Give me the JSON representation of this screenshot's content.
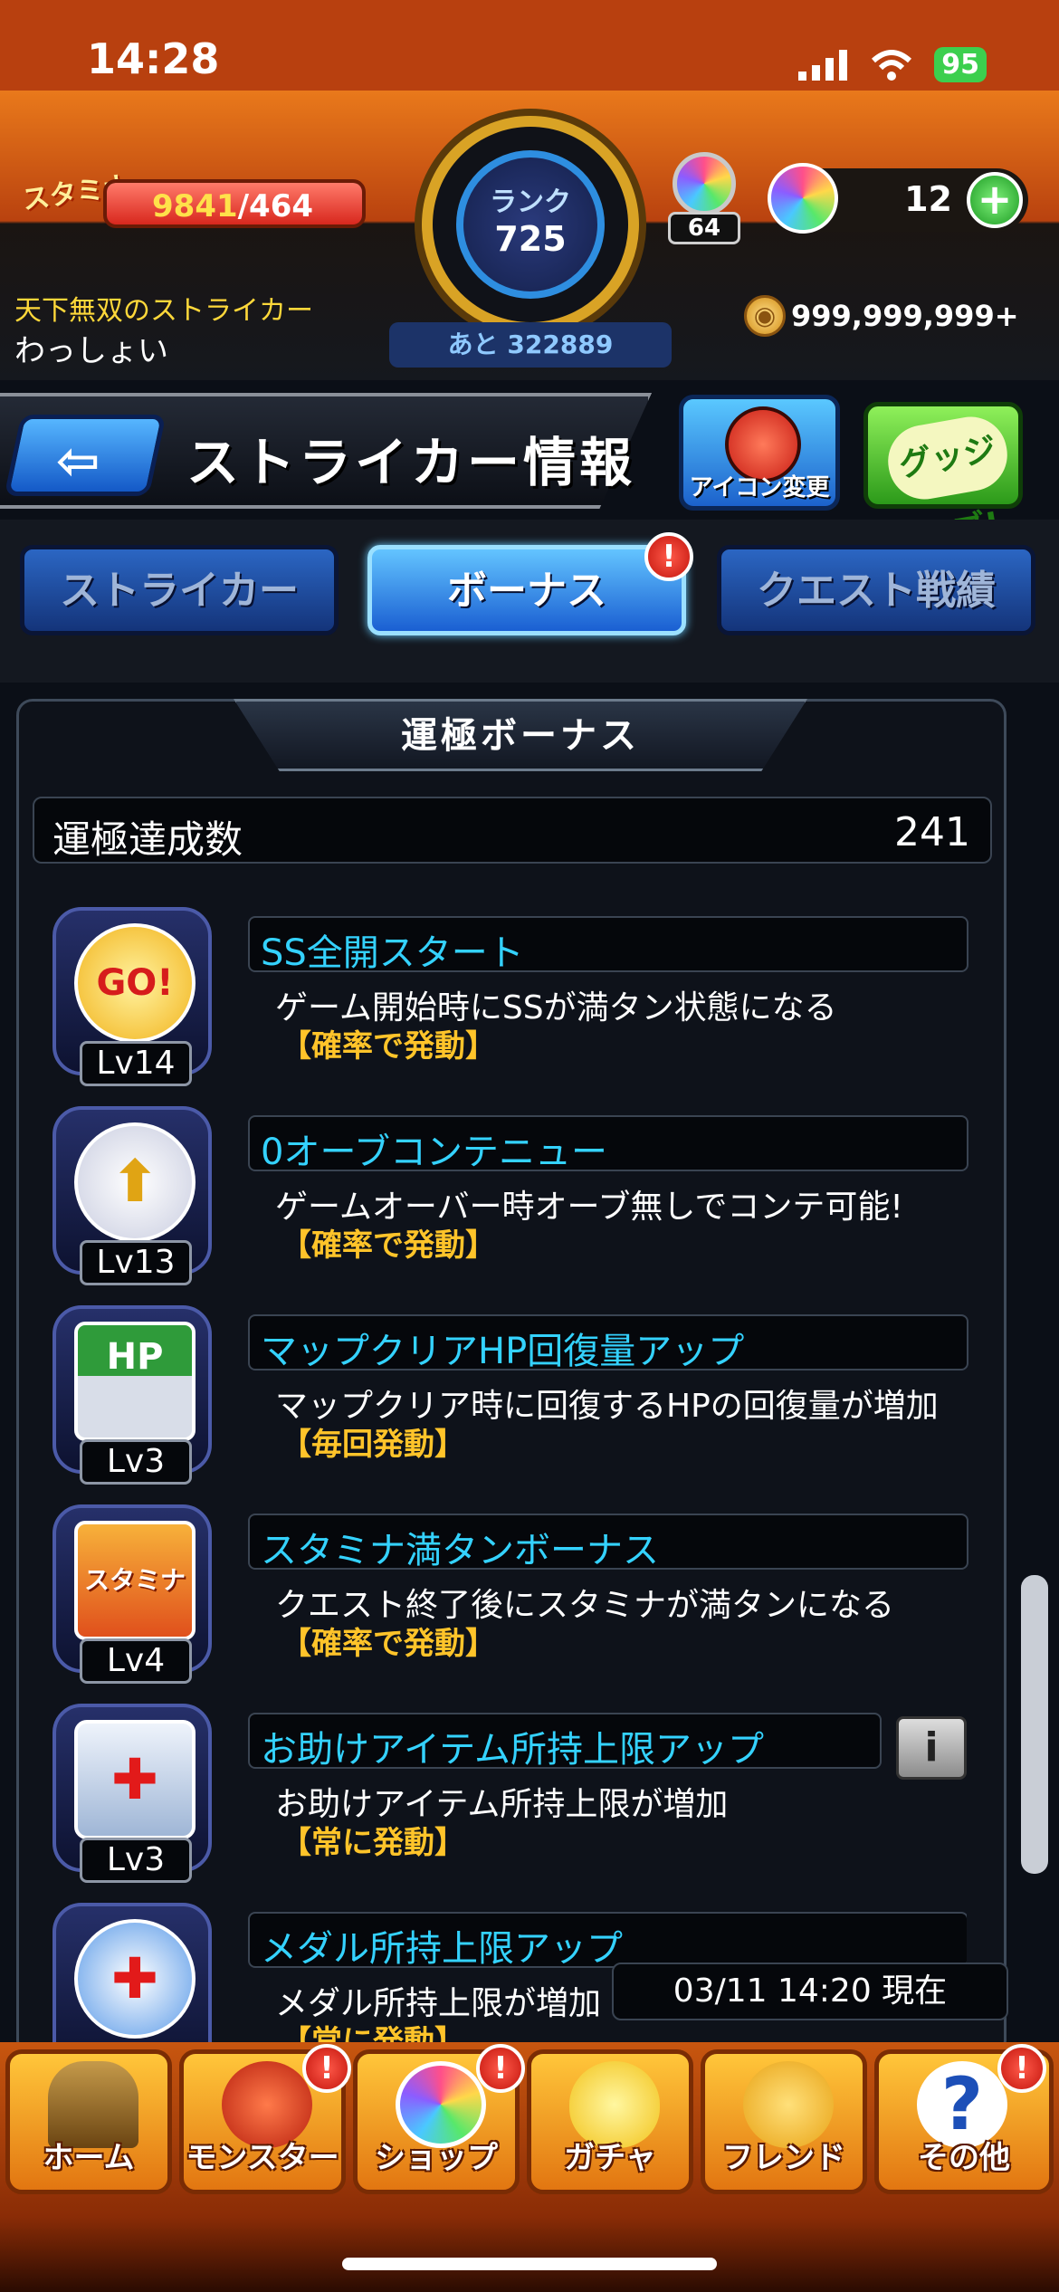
{
  "status_bar": {
    "time": "14:28",
    "battery": "95"
  },
  "header": {
    "stamina_label": "スタミナ",
    "stamina_current": "9841",
    "stamina_max": "/464",
    "rank_label": "ランク",
    "rank_value": "725",
    "next_exp": "あと 322889",
    "orb_item_count": "64",
    "orb_count": "12",
    "title": "天下無双のストライカー",
    "username": "わっしょい",
    "coins": "999,999,999+"
  },
  "titlebar": {
    "page_title": "ストライカー情報",
    "icon_change_label": "アイコン変更",
    "good_job_label": "グッジョブ!"
  },
  "tabs": [
    {
      "label": "ストライカー",
      "active": false
    },
    {
      "label": "ボーナス",
      "active": true
    },
    {
      "label": "クエスト戦績",
      "active": false
    }
  ],
  "section": {
    "title": "運極ボーナス",
    "count_label": "運極達成数",
    "count_value": "241"
  },
  "bonuses": [
    {
      "name": "SS全開スタート",
      "desc": "ゲーム開始時にSSが満タン状態になる",
      "trigger": "【確率で発動】",
      "level": "Lv14",
      "icon": "go-icon",
      "icon_text": "GO!",
      "color": "#f2b31c"
    },
    {
      "name": "0オーブコンテニュー",
      "desc": "ゲームオーバー時オーブ無しでコンテ可能!",
      "trigger": "【確率で発動】",
      "level": "Lv13",
      "icon": "winged-arrow-icon",
      "icon_text": "⬆",
      "color": "#e6e6f0"
    },
    {
      "name": "マップクリアHP回復量アップ",
      "desc": "マップクリア時に回復するHPの回復量が増加",
      "trigger": "【毎回発動】",
      "level": "Lv3",
      "icon": "hp-gauge-icon",
      "icon_text": "HP",
      "color": "#2f9b3a"
    },
    {
      "name": "スタミナ満タンボーナス",
      "desc": "クエスト終了後にスタミナが満タンになる",
      "trigger": "【確率で発動】",
      "level": "Lv4",
      "icon": "stamina-icon",
      "icon_text": "スタミナ",
      "color": "#e0781c"
    },
    {
      "name": "お助けアイテム所持上限アップ",
      "desc": "お助けアイテム所持上限が増加",
      "trigger": "【常に発動】",
      "level": "Lv3",
      "icon": "item-plus-icon",
      "icon_text": "✚",
      "color": "#7aa7d8"
    },
    {
      "name": "メダル所持上限アップ",
      "desc": "メダル所持上限が増加",
      "trigger": "【常に発動】",
      "level": "",
      "icon": "medal-plus-icon",
      "icon_text": "✚",
      "color": "#3a78d8"
    }
  ],
  "timestamp": "03/11 14:20 現在",
  "bottom_nav": [
    {
      "label": "ホーム",
      "icon": "home-gate-icon",
      "badge": false
    },
    {
      "label": "モンスター",
      "icon": "monster-icon",
      "badge": true
    },
    {
      "label": "ショップ",
      "icon": "orb-icon",
      "badge": true
    },
    {
      "label": "ガチャ",
      "icon": "egg-icon",
      "badge": false
    },
    {
      "label": "フレンド",
      "icon": "friends-icon",
      "badge": false
    },
    {
      "label": "その他",
      "icon": "question-icon",
      "badge": true
    }
  ],
  "badge_mark": "!"
}
